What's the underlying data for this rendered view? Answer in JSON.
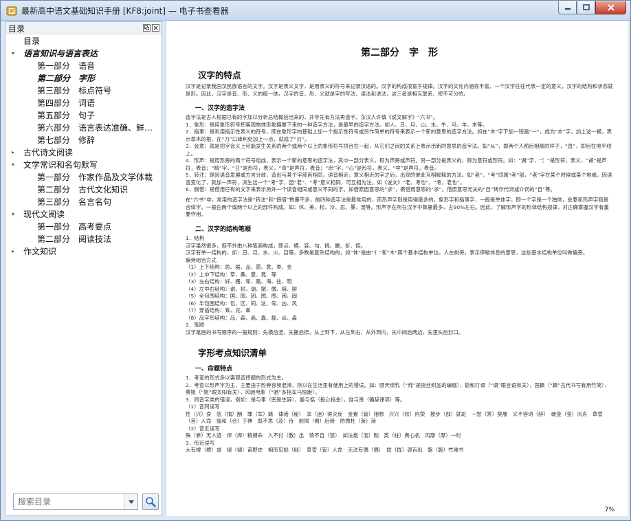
{
  "window": {
    "title": "最新高中语文基础知识手册 [KF8:joint] — 电子书查看器"
  },
  "sidebar": {
    "title": "目录",
    "tree": [
      {
        "label": "目录",
        "level": 1,
        "arrow": "",
        "part": "",
        "name": ""
      },
      {
        "label": "语言知识与语言表达",
        "level": 0,
        "arrow": "▾",
        "part": "",
        "name": "",
        "selected": true
      },
      {
        "label": "",
        "level": 2,
        "arrow": "",
        "part": "第一部分",
        "name": "语音"
      },
      {
        "label": "",
        "level": 2,
        "arrow": "",
        "part": "第二部分",
        "name": "字形",
        "selected": true
      },
      {
        "label": "",
        "level": 2,
        "arrow": "",
        "part": "第三部分",
        "name": "标点符号"
      },
      {
        "label": "",
        "level": 2,
        "arrow": "",
        "part": "第四部分",
        "name": "词语"
      },
      {
        "label": "",
        "level": 2,
        "arrow": "",
        "part": "第五部分",
        "name": "句子"
      },
      {
        "label": "",
        "level": 2,
        "arrow": "",
        "part": "第六部分",
        "name": "语言表达准确、鲜…"
      },
      {
        "label": "",
        "level": 2,
        "arrow": "",
        "part": "第七部分",
        "name": "修辞"
      },
      {
        "label": "古代诗文阅读",
        "level": 0,
        "arrow": "▸",
        "part": "",
        "name": ""
      },
      {
        "label": "文学常识和名句默写",
        "level": 0,
        "arrow": "▾",
        "part": "",
        "name": ""
      },
      {
        "label": "",
        "level": 2,
        "arrow": "",
        "part": "第一部分",
        "name": "作家作品及文学体裁"
      },
      {
        "label": "",
        "level": 2,
        "arrow": "",
        "part": "第二部分",
        "name": "古代文化知识"
      },
      {
        "label": "",
        "level": 2,
        "arrow": "",
        "part": "第三部分",
        "name": "名言名句"
      },
      {
        "label": "现代文阅读",
        "level": 0,
        "arrow": "▾",
        "part": "",
        "name": ""
      },
      {
        "label": "",
        "level": 2,
        "arrow": "",
        "part": "第一部分",
        "name": "高考要点"
      },
      {
        "label": "",
        "level": 2,
        "arrow": "",
        "part": "第二部分",
        "name": "阅读技法"
      },
      {
        "label": "作文知识",
        "level": 0,
        "arrow": "▸",
        "part": "",
        "name": ""
      }
    ],
    "search_placeholder": "搜索目录"
  },
  "document": {
    "heading": "第二部分　字　形",
    "sections": [
      {
        "type": "h2",
        "text": "汉字的特点"
      },
      {
        "type": "p",
        "text": "汉字是记录我国汉民族语言的文字。汉字是表义文字，是用表义的符号来记录汉语的。汉字的构成很富于规律。汉字的文化内涵很丰富，一个汉字往往代表一定的意义，汉字的结构和状态就是形。因此，汉字是音、形、义的统一体，汉字的音、形、义就是字的写法、读法和讲法，这三者是相互联系、密不可分的。"
      },
      {
        "type": "h3",
        "text": "一、汉字的造字法"
      },
      {
        "type": "p",
        "text": "造字法是古人根据已有的字加以分析总结概括出来的，并非先有方法再造字。东汉人许慎《说文解字》“六书”。\n1．象形：是用象形符号把客观物体形象描摹下来的一种造字方法，是最早的造字方法。如人、日、月、山、水、牛、马、羊、木等。\n2．指事：是利用指示性表义的符号，即在象形字的基础上加一个指示性符号或另作简单的符号来表示一个新的意思的造字方法。如在“木”字下加一短画“一”，成为“本”字，加上这一横，表示草木的根，在“刀”口锋利处加上一点，就成了“刃”。\n3．会意：就是把字会义上可能发生关系的两个或两个以上的象形符号拼合在一起，从它们之间的关系上表示出新的意思的造字法。如“从”，即两个人前后相随的样子，“直”，即目在地平线上。\n4．形声：是用形旁的两个符号组成，表示一个新的意思的造字法，其中一部分表义，称为声旁或声符。另一部分是表义的，称为意符或形符。如：“湖”字，“氵”是形符，表义，“胡”是声符，表音；“晴”字，“日”是形符，表义，“青”是声符，表音；“忠”字，“心”是形符，表义，“中”是声符，表音。\n5．转注：是因语音发展或方言分歧，造出与某个字部首相同，读音相近，意义相近的字之后，出现的彼此互相解释的方法。如“老”、“考”同属“老”部，“老”字在某个时候或某个地域，因读音变化了，就加一声符，派生出一个“考”字，因“老”、“考”意义相同，可互相为注。如《说文》“老，考也”，“考，老也”。\n6．假借：是借用已有的文字来表示另外一个读音相同或意义不同的字。如借原因意思的“求”，裘借用意思的“求”。借原意思无关的“自”转作代词或介词的“自”等。"
      },
      {
        "type": "p",
        "text": "在“六书”中，常用的造字法是“转注”和“假借”数量不多，前四种造字法是最常用的，而形声字则是用得最多的。象形字和指事字，一般是单体字，即一个字是一个独体，会意和形声字则是合体字。一般由两个或两个以上的部件构成。如：休、美、松、冷、忍、暴、湿等。形声字在所在汉字中数量最多，占90%左右。因此，了解形声字的形体结构规律，对正确掌握汉字有重要作用。"
      },
      {
        "type": "h3",
        "text": "二、汉字的结构笔顺"
      },
      {
        "type": "p",
        "text": "1．结构\n汉字虽然很多，但不外由八种笔画构成，即点、横、竖、勾、挑、撇、折、捺。\n汉字有单一结构的，如：日、月、水、火、目等，多数是复杂结构的，如“休”是由“亻”和“木”两个基本结构单位，人在树旁，表示停歇休息的意思，这些基本结构单位叫做偏旁。\n偏旁组合方式\n（1）上下结构：思、器、品、晨、意、类、金\n（2）上中下结构：草、桑、意、竟、等\n（3）左右结构：好、棚、和、路、海、往、明\n（4）左中右结构：谢、树、湖、撤、微、辦、辯\n（5）全包围结构：国、园、因、图、围、困、固\n（6）半包围结构：包、区、同、这、匈、凶、风\n（7）穿插结构：乘、兆、串\n（8）品字形结构：品、森、晶、鑫、磊、焱、淼\n2．笔顺\n汉字笔画的书写顺序的一般规则：先横后竖，先撇后捺，从上到下，从左到右，从外到内，先中间后两边，先里头后封口。"
      },
      {
        "type": "h2",
        "text": "字形考点知识清单"
      },
      {
        "type": "h3",
        "text": "一、命题特点"
      },
      {
        "type": "p",
        "text": "1．考查的形式多以客观选择题的形式为主。\n2．考查以形声字为主，主要由于形旁容易混淆，所以在生活里有使用上的错误。如：颐天绵乳（“绵”是指丝织品的编缀），掂和打谓（“谓”眼言语有关），国籍（“籍”古代书写有用竹简），蔡姐（“姐”跟太阳有关），风驰电掣（“驰”多指车马快跑）。\n3．同音字类的错误，例如：是与事（密是生辞），殷与惦（投心指金），谁与贵（确辞谏项）等。\n（1）音同误写\n性（兴）食　怨（捐）酬　罪（军）籍　律诺（秘）　享（迷）得灭反　金置（管）相想　兴兴（欣）向荣　按步（部）就班　一愁（筹）莫展　义不容词（辞）　破釜（釜）沉舟　草菅（首）人命　毁和（合）于神　既不思（及）待　前揭（倡）后继　防微杜（渐）渐\n（2）音近误写\n殊（参）无人迹　悍（焊）精搏命　入不付（敷）出　情不自（禁）　如法炮（泡）制　英（柱）费心机　风靡（靡）一时\n3．形近误写\n大有裨（裨）益　褪（褪）苗野史　相形见拙（绌）　草菅（管）人命　无法有偶（偶）　拢（拢）源百出　磐（磐）竹难书"
      }
    ],
    "zoom": "7%"
  }
}
